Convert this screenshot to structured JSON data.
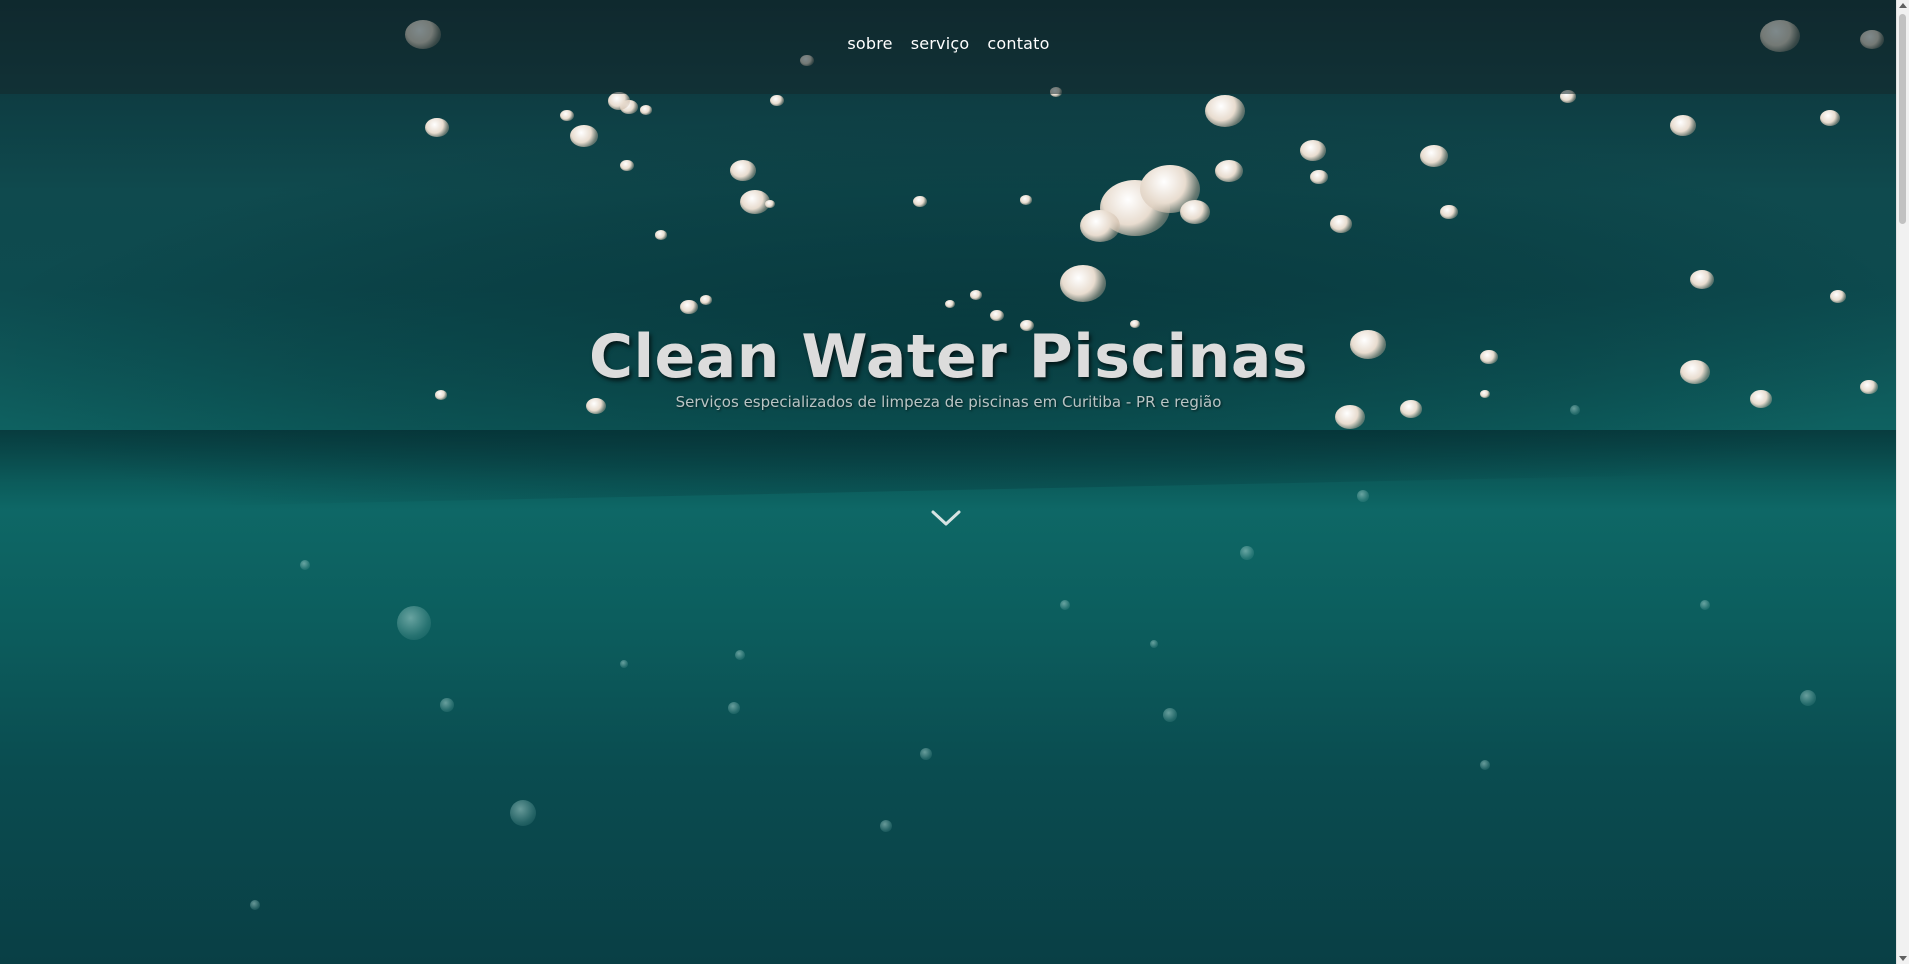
{
  "nav": {
    "items": [
      {
        "label": "sobre"
      },
      {
        "label": "serviço"
      },
      {
        "label": "contato"
      }
    ]
  },
  "hero": {
    "title": "Clean Water Piscinas",
    "subtitle": "Serviços especializados de limpeza de piscinas em Curitiba - PR e região",
    "scroll_icon": "chevron-down-icon"
  },
  "colors": {
    "water_top": "#0b2a31",
    "water_mid": "#0e6a68",
    "water_bottom": "#093f45",
    "title": "#dcdcdc",
    "nav_text": "#ffffff"
  }
}
